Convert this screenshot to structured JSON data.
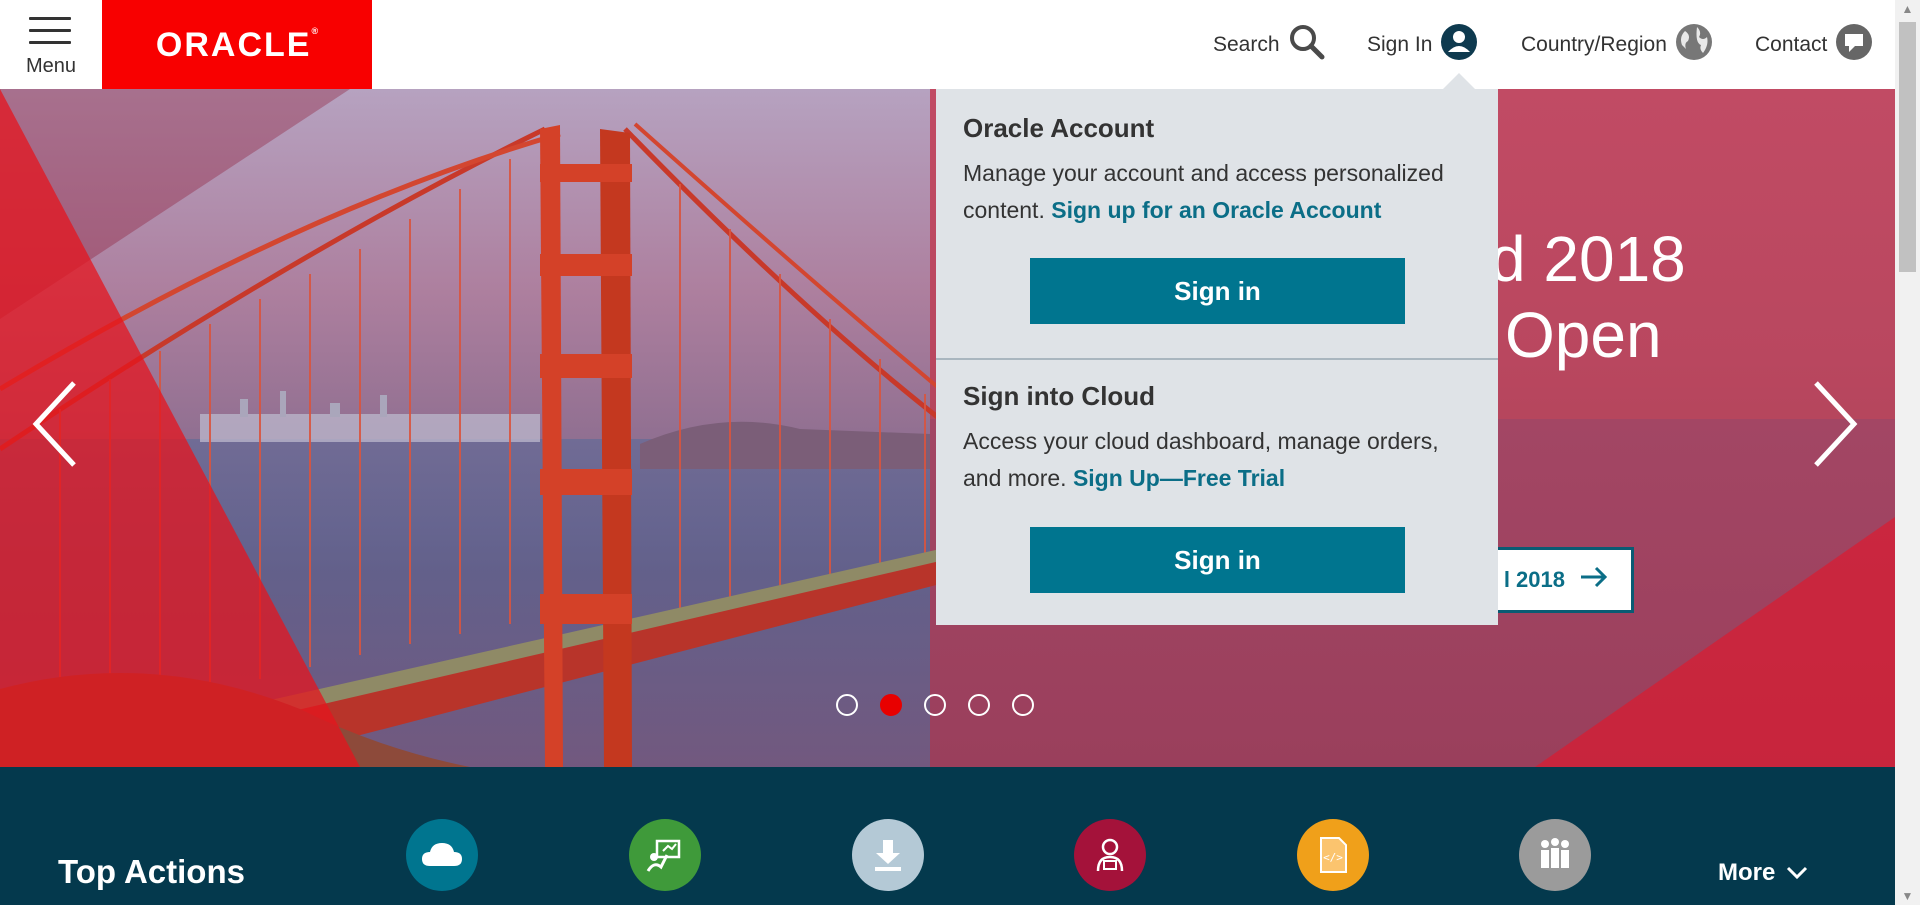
{
  "header": {
    "menu_label": "Menu",
    "logo_text": "ORACLE",
    "logo_mark": "®",
    "nav": {
      "search": "Search",
      "sign_in": "Sign In",
      "country": "Country/Region",
      "contact": "Contact"
    }
  },
  "hero": {
    "headline_line1": "d 2018",
    "headline_line2": "Open",
    "cta_label": "l 2018",
    "slides": 5,
    "active_slide": 2
  },
  "signin_dropdown": {
    "account": {
      "title": "Oracle Account",
      "text": "Manage your account and access personalized content.",
      "link": "Sign up for an Oracle Account",
      "button": "Sign in"
    },
    "cloud": {
      "title": "Sign into Cloud",
      "text": "Access your cloud dashboard, manage orders, and more.",
      "link": "Sign Up—Free Trial",
      "button": "Sign in"
    }
  },
  "top_actions": {
    "title": "Top Actions",
    "more_label": "More",
    "items": [
      {
        "icon": "cloud-icon",
        "color": "#00758f"
      },
      {
        "icon": "training-icon",
        "color": "#3f9a3a"
      },
      {
        "icon": "download-icon",
        "color": "#b4c9d6"
      },
      {
        "icon": "support-person-icon",
        "color": "#a4123a"
      },
      {
        "icon": "code-document-icon",
        "color": "#f0a01a"
      },
      {
        "icon": "people-icon",
        "color": "#9b9b9b"
      }
    ]
  },
  "colors": {
    "brand_red": "#f80000",
    "teal": "#00758f",
    "dark_navy": "#04394d"
  }
}
